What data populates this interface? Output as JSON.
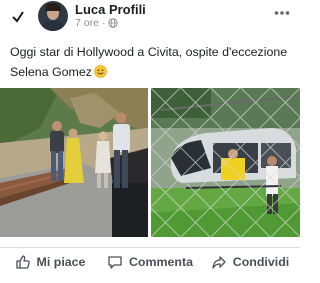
{
  "post": {
    "author": "Luca Profili",
    "time": "7 ore",
    "separator": "·",
    "text_line1": "Oggi star di Hollywood a Civita, ospite d'eccezione",
    "text_line2": "Selena Gomez",
    "emoji": "smiling-face"
  },
  "actions": {
    "like": "Mi piace",
    "comment": "Commenta",
    "share": "Condividi"
  },
  "icons": {
    "verified": "check-icon",
    "privacy": "globe-icon",
    "more": "more-icon"
  },
  "colors": {
    "action_gray": "#4b4f56",
    "meta_gray": "#8a8d91"
  }
}
